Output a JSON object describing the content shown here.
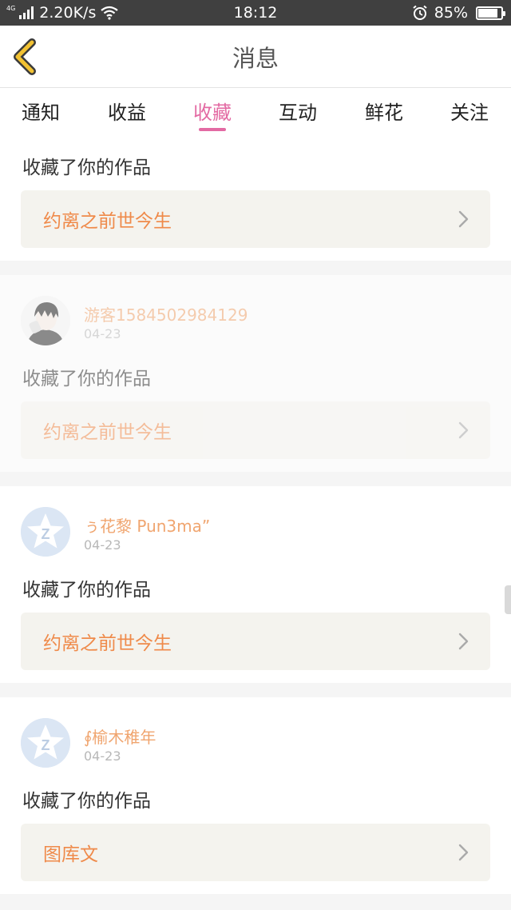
{
  "status_bar": {
    "network_tag": "4G",
    "speed": "2.20K/s",
    "time": "18:12",
    "battery": "85%",
    "battery_level": 0.85
  },
  "header": {
    "title": "消息"
  },
  "tabs": [
    {
      "label": "通知",
      "active": false
    },
    {
      "label": "收益",
      "active": false
    },
    {
      "label": "收藏",
      "active": true
    },
    {
      "label": "互动",
      "active": false
    },
    {
      "label": "鲜花",
      "active": false
    },
    {
      "label": "关注",
      "active": false
    }
  ],
  "messages": [
    {
      "action": "收藏了你的作品",
      "work_title": "约离之前世今生"
    },
    {
      "username": "游客1584502984129",
      "date": "04-23",
      "avatar": "anime-boy-avatar",
      "action": "收藏了你的作品",
      "work_title": "约离之前世今生"
    },
    {
      "username": "ぅ花黎 Pun3ma”",
      "date": "04-23",
      "avatar": "default-star-avatar",
      "action": "收藏了你的作品",
      "work_title": "约离之前世今生"
    },
    {
      "username": "∮榆木稚年",
      "date": "04-23",
      "avatar": "default-star-avatar",
      "action": "收藏了你的作品",
      "work_title": "图库文"
    }
  ],
  "colors": {
    "accent": "#e36aa3",
    "username": "#f0a56f",
    "work_title": "#ef8a4a",
    "back_arrow": "#f2c232",
    "card_bg": "#f4f3ee"
  }
}
